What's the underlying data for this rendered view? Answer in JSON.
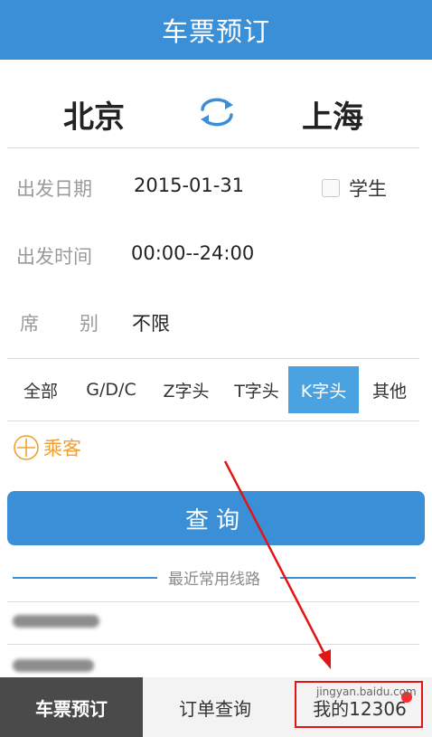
{
  "header": {
    "title": "车票预订"
  },
  "stations": {
    "from": "北京",
    "to": "上海"
  },
  "form": {
    "date_label": "出发日期",
    "date_value": "2015-01-31",
    "time_label": "出发时间",
    "time_value": "00:00--24:00",
    "seat_label_1": "席",
    "seat_label_2": "别",
    "seat_value": "不限",
    "student_label": "学生"
  },
  "filters": [
    {
      "label": "全部"
    },
    {
      "label": "G/D/C"
    },
    {
      "label": "Z字头"
    },
    {
      "label": "T字头"
    },
    {
      "label": "K字头",
      "active": true
    },
    {
      "label": "其他"
    }
  ],
  "passenger": {
    "label": "乘客"
  },
  "search_button": {
    "label": "查询"
  },
  "recent": {
    "title": "最近常用线路"
  },
  "tabs": [
    {
      "label": "车票预订",
      "active": true
    },
    {
      "label": "订单查询"
    },
    {
      "label": "我的12306"
    }
  ],
  "watermark": "jingyan.baidu.com",
  "colors": {
    "accent": "#3b8fd6",
    "active_filter": "#4aa3e0",
    "passenger": "#f0a033",
    "annotation": "#e31414"
  }
}
